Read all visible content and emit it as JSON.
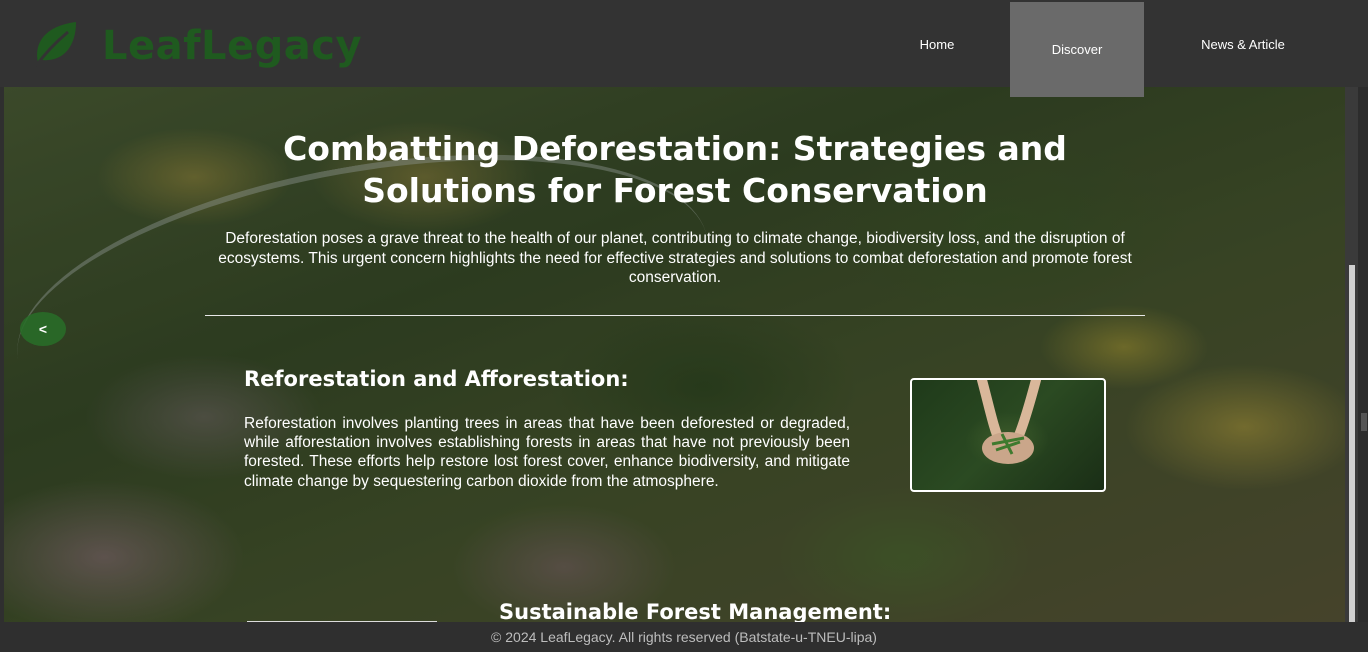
{
  "brand": {
    "name": "LeafLegacy",
    "logo_icon": "leaf-icon",
    "color": "#1f5a1f"
  },
  "nav": {
    "items": [
      {
        "label": "Home",
        "active": false
      },
      {
        "label": "Discover",
        "active": true
      },
      {
        "label": "News & Article",
        "active": false
      }
    ],
    "active_bg": "#6a6a6a"
  },
  "hero": {
    "title": "Combatting Deforestation: Strategies and Solutions for Forest Conservation",
    "intro": "Deforestation poses a grave threat to the health of our planet, contributing to climate change, biodiversity loss, and the disruption of ecosystems. This urgent concern highlights the need for effective strategies and solutions to combat deforestation and promote forest conservation.",
    "prev_label": "<"
  },
  "sections": [
    {
      "title": "Reforestation and Afforestation:",
      "text": "Reforestation involves planting trees in areas that have been deforested or degraded, while afforestation involves establishing forests in areas that have not previously been forested. These efforts help restore lost forest cover, enhance biodiversity, and mitigate climate change by sequestering carbon dioxide from the atmosphere.",
      "image": "hands-holding-seedling"
    },
    {
      "title": "Sustainable Forest Management:"
    }
  ],
  "footer": {
    "text": "© 2024 LeafLegacy. All rights reserved (Batstate-u-TNEU-lipa)"
  }
}
